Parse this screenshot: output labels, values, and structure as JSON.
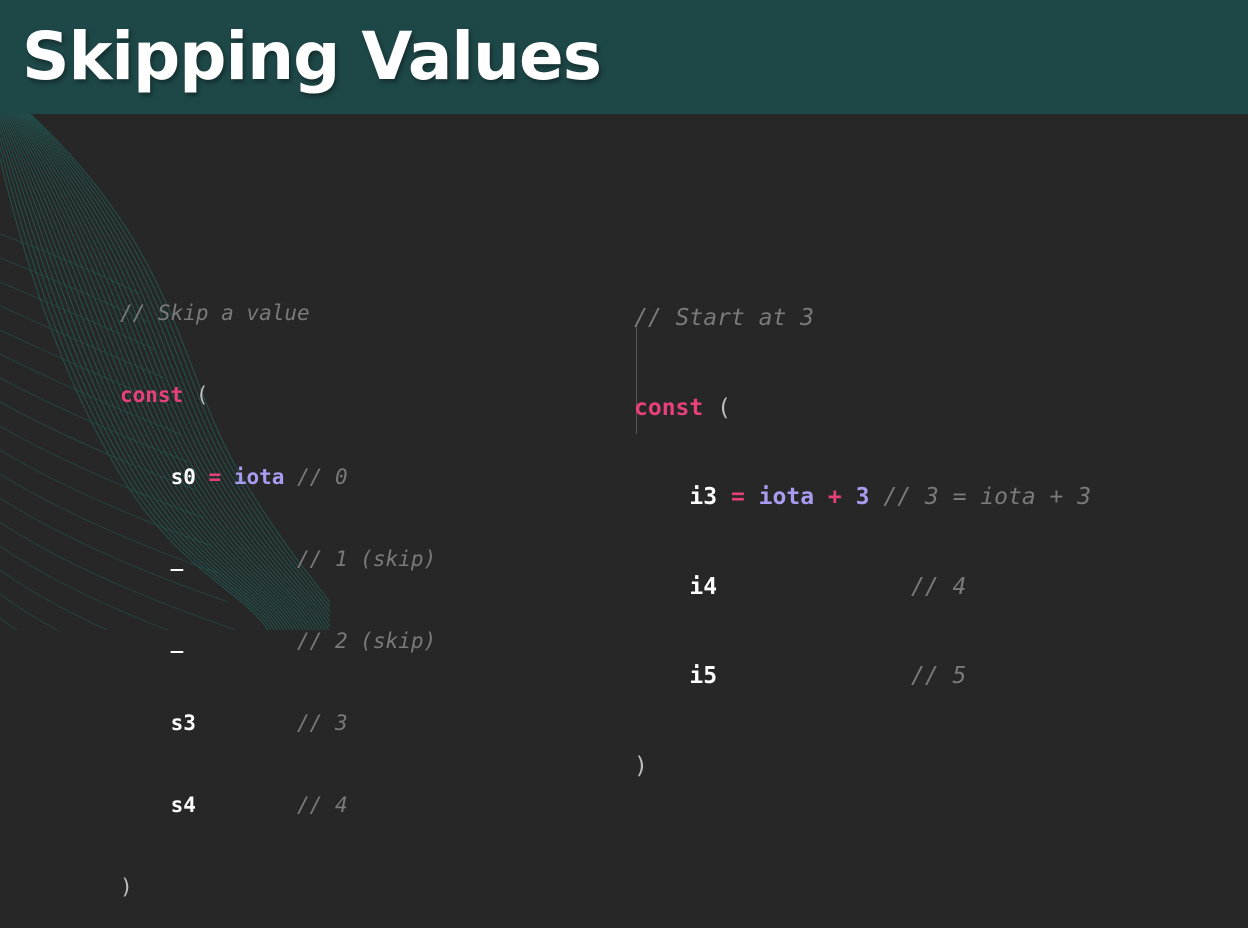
{
  "slide": {
    "title": "Skipping Values"
  },
  "left_code": {
    "comment_header": "// Skip a value",
    "const_kw": "const",
    "open_paren": "(",
    "s0_ident": "s0",
    "s0_eq": "=",
    "s0_iota": "iota",
    "s0_comment": "// 0",
    "skip1_ident": "_",
    "skip1_comment": "// 1 (skip)",
    "skip2_ident": "_",
    "skip2_comment": "// 2 (skip)",
    "s3_ident": "s3",
    "s3_comment": "// 3",
    "s4_ident": "s4",
    "s4_comment": "// 4",
    "close_paren": ")"
  },
  "right_code": {
    "comment_header": "// Start at 3",
    "const_kw": "const",
    "open_paren": "(",
    "i3_ident": "i3",
    "i3_eq": "=",
    "i3_iota": "iota",
    "i3_plus": "+",
    "i3_num": "3",
    "i3_comment": "// 3 = iota + 3",
    "i4_ident": "i4",
    "i4_comment": "// 4",
    "i5_ident": "i5",
    "i5_comment": "// 5",
    "close_paren": ")"
  },
  "colors": {
    "title_bar": "#1e4747",
    "background": "#272727",
    "keyword": "#e8407a",
    "iota": "#a99cf0",
    "comment": "#7a7a7a"
  }
}
